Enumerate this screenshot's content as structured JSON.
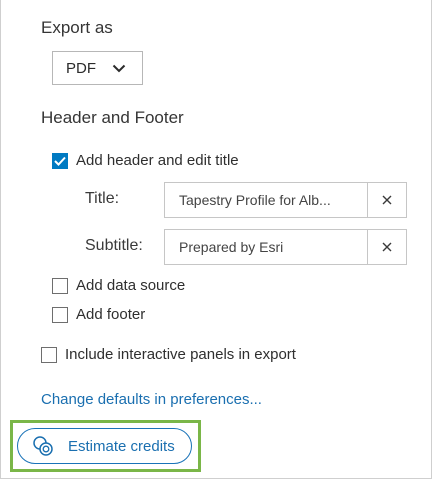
{
  "export_as": {
    "heading": "Export as",
    "format_selected": "PDF"
  },
  "header_footer": {
    "heading": "Header and Footer",
    "add_header": {
      "label": "Add header and edit title",
      "checked": true
    },
    "title": {
      "label": "Title:",
      "value": "Tapestry Profile for Alb..."
    },
    "subtitle": {
      "label": "Subtitle:",
      "value": "Prepared by Esri"
    },
    "add_data_source": {
      "label": "Add data source",
      "checked": false
    },
    "add_footer": {
      "label": "Add footer",
      "checked": false
    }
  },
  "include_panels": {
    "label": "Include interactive panels in export",
    "checked": false
  },
  "preferences_link": "Change defaults in preferences...",
  "estimate_button": "Estimate credits",
  "colors": {
    "accent": "#007ac2",
    "link": "#1a6fb0",
    "highlight": "#7ab648"
  }
}
